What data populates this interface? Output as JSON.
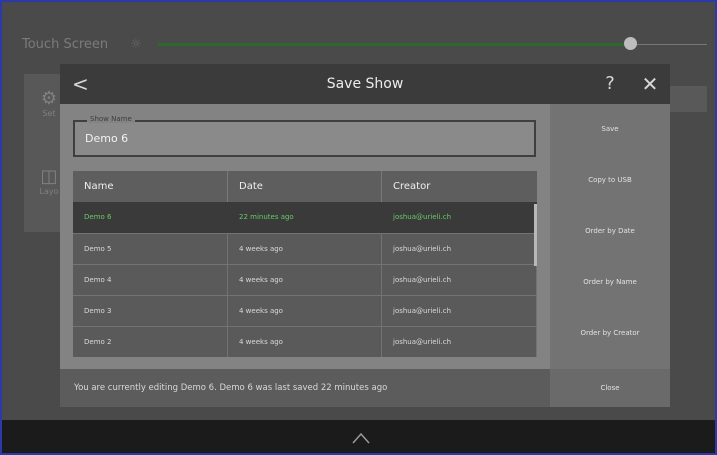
{
  "background": {
    "title": "Touch Screen",
    "sun_icon": "sun-icon",
    "panel_items": [
      "Set",
      "Layo"
    ],
    "slider_color": "#2d6a2d"
  },
  "dialog": {
    "title": "Save Show",
    "back_label": "<",
    "help_label": "?",
    "close_label": "✕",
    "show_name": {
      "legend": "Show Name",
      "value": "Demo 6"
    },
    "table": {
      "columns": [
        "Name",
        "Date",
        "Creator"
      ],
      "rows": [
        {
          "name": "Demo 6",
          "date": "22 minutes ago",
          "creator": "joshua@urieli.ch",
          "selected": true
        },
        {
          "name": "Demo 5",
          "date": "4 weeks ago",
          "creator": "joshua@urieli.ch",
          "selected": false
        },
        {
          "name": "Demo 4",
          "date": "4 weeks ago",
          "creator": "joshua@urieli.ch",
          "selected": false
        },
        {
          "name": "Demo 3",
          "date": "4 weeks ago",
          "creator": "joshua@urieli.ch",
          "selected": false
        },
        {
          "name": "Demo 2",
          "date": "4 weeks ago",
          "creator": "joshua@urieli.ch",
          "selected": false
        }
      ]
    },
    "side_buttons": {
      "save": "Save",
      "copy_to_usb": "Copy to USB",
      "order_by_date": "Order by Date",
      "order_by_name": "Order by Name",
      "order_by_creator": "Order by Creator"
    },
    "footer": {
      "status": "You are currently editing Demo 6. Demo 6 was last saved 22 minutes ago",
      "close": "Close"
    },
    "accent_color": "#69c869"
  },
  "bottom_bar": {
    "icon": "chevron-up-icon"
  }
}
